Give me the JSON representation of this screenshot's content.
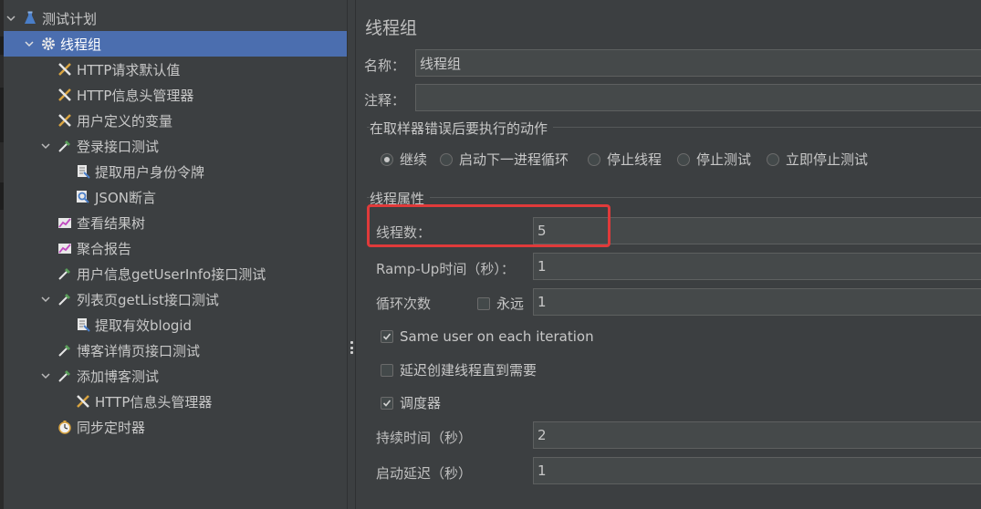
{
  "tree": {
    "items": [
      {
        "label": "测试计划",
        "icon": "flask-icon",
        "expanded": true
      },
      {
        "label": "线程组",
        "icon": "gear-icon",
        "expanded": true,
        "selected": true
      },
      {
        "label": "HTTP请求默认值",
        "icon": "wrench-icon"
      },
      {
        "label": "HTTP信息头管理器",
        "icon": "wrench-icon"
      },
      {
        "label": "用户定义的变量",
        "icon": "wrench-icon"
      },
      {
        "label": "登录接口测试",
        "icon": "pipette-icon",
        "expanded": true
      },
      {
        "label": "提取用户身份令牌",
        "icon": "extractor-icon"
      },
      {
        "label": "JSON断言",
        "icon": "magnifier-icon"
      },
      {
        "label": "查看结果树",
        "icon": "graph-icon"
      },
      {
        "label": "聚合报告",
        "icon": "graph-icon"
      },
      {
        "label": "用户信息getUserInfo接口测试",
        "icon": "pipette-icon"
      },
      {
        "label": "列表页getList接口测试",
        "icon": "pipette-icon",
        "expanded": true
      },
      {
        "label": "提取有效blogid",
        "icon": "extractor-icon"
      },
      {
        "label": "博客详情页接口测试",
        "icon": "pipette-icon"
      },
      {
        "label": "添加博客测试",
        "icon": "pipette-icon",
        "expanded": true
      },
      {
        "label": "HTTP信息头管理器",
        "icon": "wrench-icon"
      },
      {
        "label": "同步定时器",
        "icon": "timer-icon"
      }
    ]
  },
  "panel": {
    "title": "线程组",
    "name_label": "名称：",
    "name_value": "线程组",
    "comment_label": "注释：",
    "comment_value": "",
    "error_group_title": "在取样器错误后要执行的动作",
    "error_options": [
      {
        "label": "继续",
        "checked": true
      },
      {
        "label": "启动下一进程循环",
        "checked": false
      },
      {
        "label": "停止线程",
        "checked": false
      },
      {
        "label": "停止测试",
        "checked": false
      },
      {
        "label": "立即停止测试",
        "checked": false
      }
    ],
    "props_group_title": "线程属性",
    "threads_label": "线程数：",
    "threads_value": "5",
    "rampup_label": "Ramp-Up时间（秒）：",
    "rampup_value": "1",
    "loop_label": "循环次数",
    "forever_label": "永远",
    "forever_checked": false,
    "loop_value": "1",
    "same_user_label": "Same user on each iteration",
    "same_user_checked": true,
    "delay_label": "延迟创建线程直到需要",
    "delay_checked": false,
    "scheduler_label": "调度器",
    "scheduler_checked": true,
    "duration_label": "持续时间（秒）",
    "duration_value": "2",
    "startup_delay_label": "启动延迟（秒）",
    "startup_delay_value": "1"
  },
  "colors": {
    "background": "#3c3f41",
    "selection": "#4b6eaf",
    "field_bg": "#45494a",
    "highlight": "#e03a3a"
  }
}
